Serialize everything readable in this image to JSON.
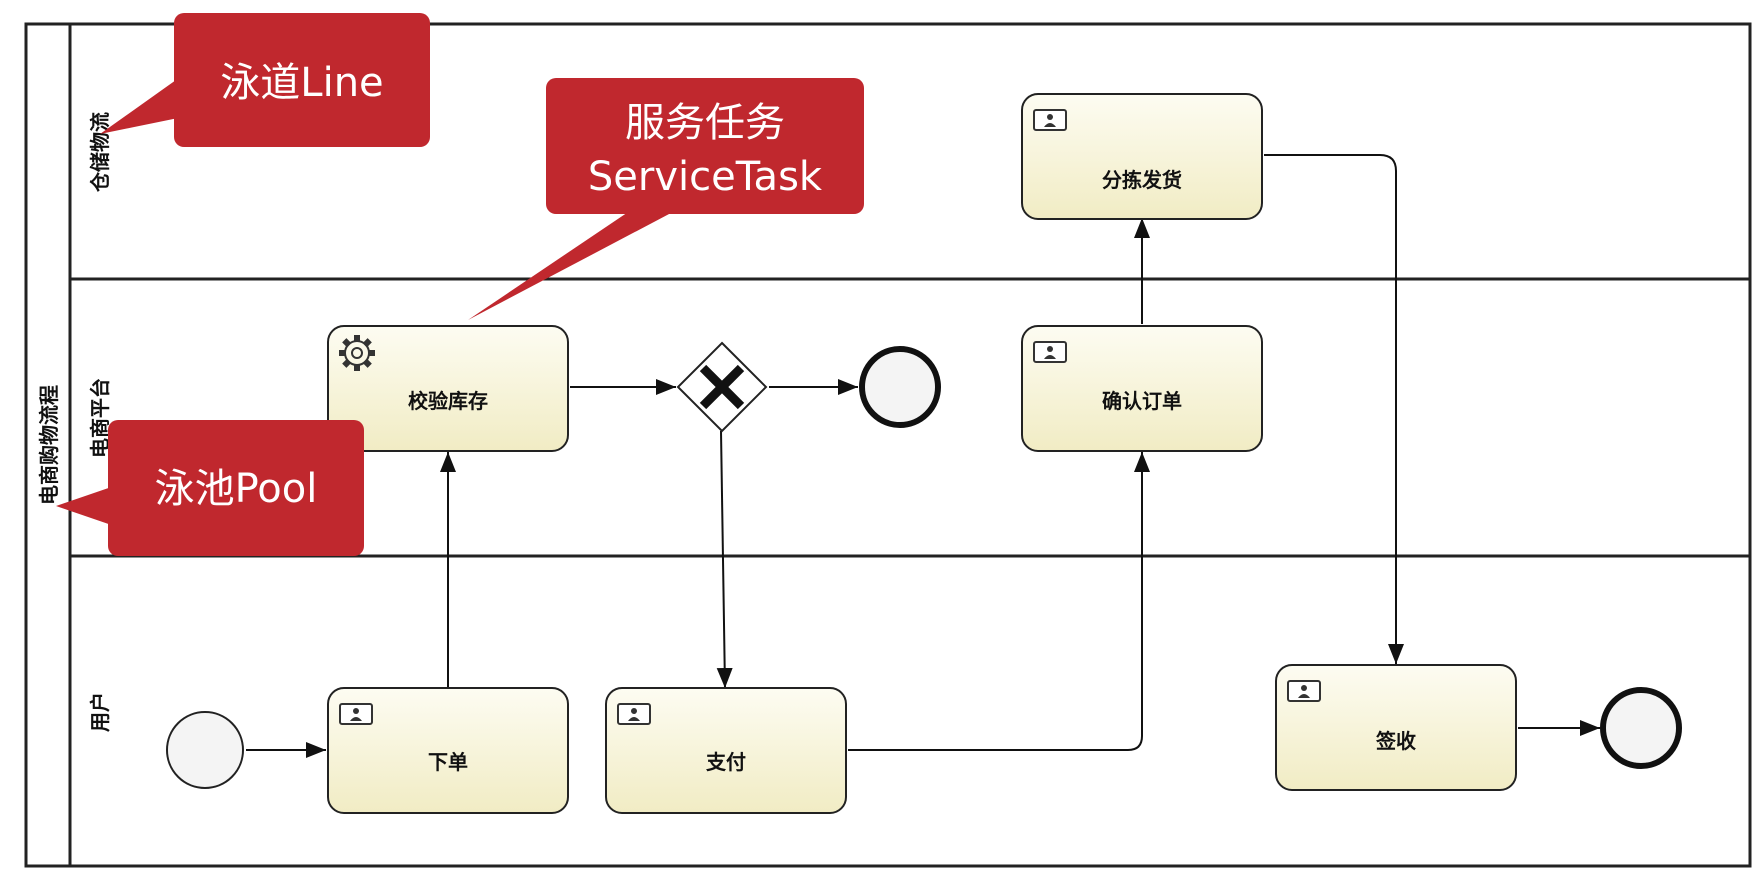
{
  "pool": {
    "name": "电商购物流程"
  },
  "lanes": [
    {
      "id": "warehouse",
      "name": "仓储物流"
    },
    {
      "id": "platform",
      "name": "电商平台"
    },
    {
      "id": "user",
      "name": "用户"
    }
  ],
  "tasks": {
    "place_order": {
      "label": "下单",
      "type": "user-task",
      "icon": "user-task-icon"
    },
    "pay": {
      "label": "支付",
      "type": "user-task",
      "icon": "user-task-icon"
    },
    "check_stock": {
      "label": "校验库存",
      "type": "service-task",
      "icon": "gear-icon"
    },
    "confirm_order": {
      "label": "确认订单",
      "type": "user-task",
      "icon": "user-task-icon"
    },
    "pick_ship": {
      "label": "分拣发货",
      "type": "user-task",
      "icon": "user-task-icon"
    },
    "sign": {
      "label": "签收",
      "type": "user-task",
      "icon": "user-task-icon"
    }
  },
  "gateway": {
    "type": "exclusive",
    "icon": "x-icon"
  },
  "callouts": {
    "lane": {
      "line1": "泳道Line"
    },
    "service_task": {
      "line1": "服务任务",
      "line2": "ServiceTask"
    },
    "pool": {
      "line1": "泳池Pool"
    }
  },
  "colors": {
    "task_fill_top": "#fdfcf2",
    "task_fill_bottom": "#f1ecc4",
    "callout": "#c0282e",
    "line": "#111111"
  }
}
